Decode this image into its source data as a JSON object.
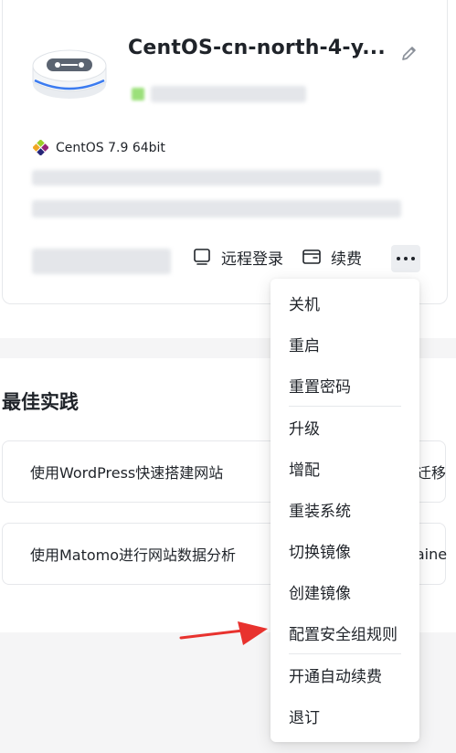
{
  "server": {
    "name": "CentOS-cn-north-4-y...",
    "os_label": "CentOS 7.9 64bit"
  },
  "actions": {
    "remote_login": "远程登录",
    "renew": "续费"
  },
  "menu": {
    "items": [
      {
        "label": "关机"
      },
      {
        "label": "重启"
      },
      {
        "label": "重置密码"
      },
      {
        "label": "升级"
      },
      {
        "label": "增配"
      },
      {
        "label": "重装系统"
      },
      {
        "label": "切换镜像"
      },
      {
        "label": "创建镜像"
      },
      {
        "label": "配置安全组规则"
      },
      {
        "label": "开通自动续费"
      },
      {
        "label": "退订"
      }
    ]
  },
  "best_practices": {
    "title": "最佳实践",
    "cards": [
      {
        "label": "使用WordPress快速搭建网站"
      },
      {
        "label": "机迁移"
      },
      {
        "label": "使用Matomo进行网站数据分析"
      },
      {
        "label": "rtaine"
      }
    ]
  },
  "colors": {
    "arrow": "#e8322e",
    "status": "#9be07a"
  },
  "icons": {
    "edit": "pencil-icon",
    "os": "centos-logo-icon",
    "remote_login": "monitor-icon",
    "renew": "wallet-icon",
    "more": "more-icon"
  }
}
